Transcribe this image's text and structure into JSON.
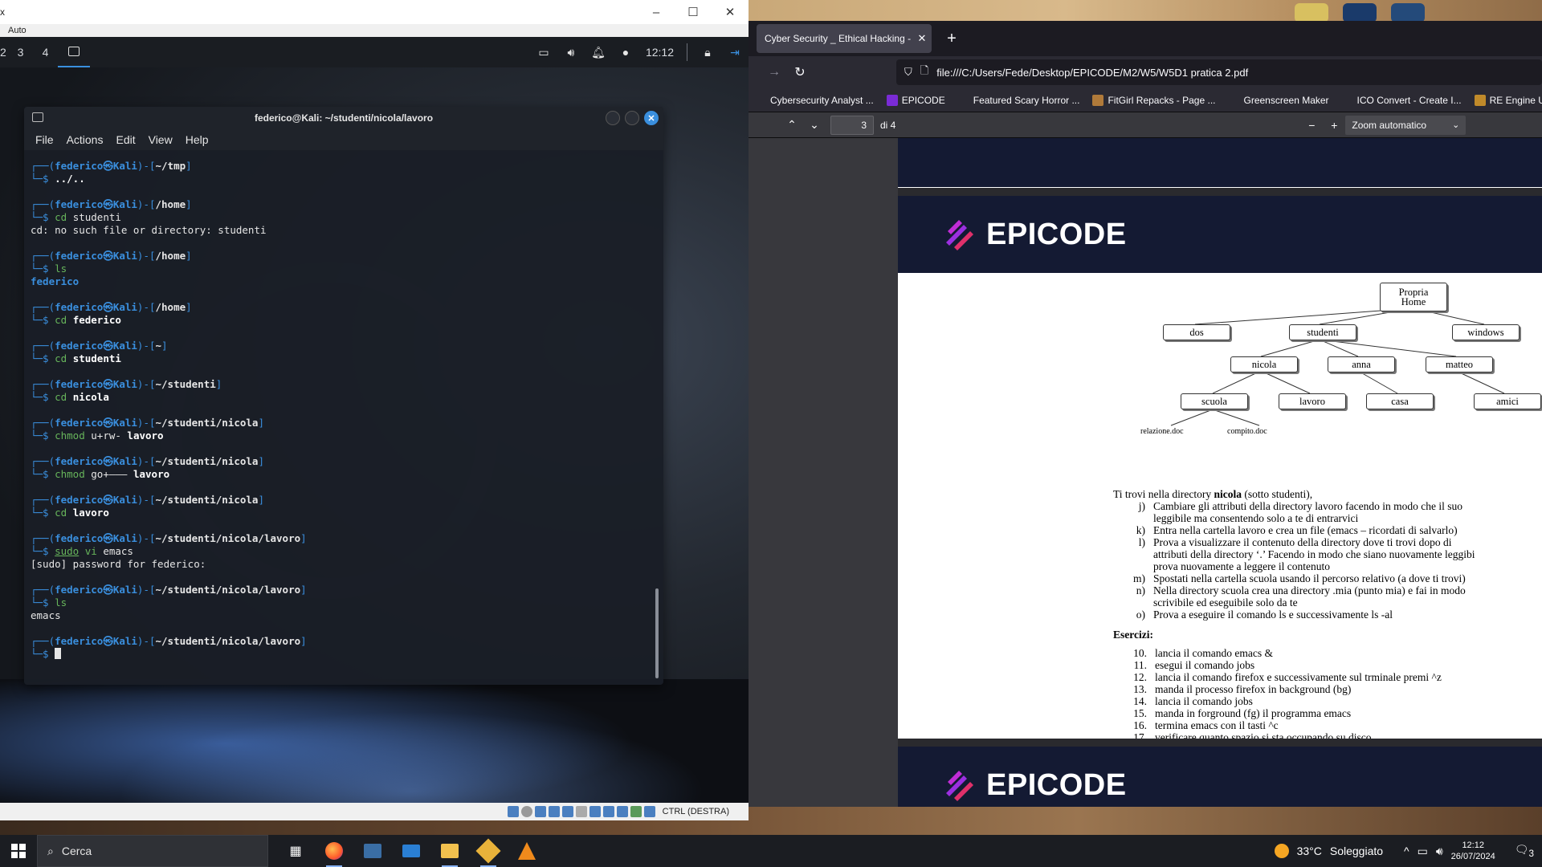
{
  "vbox": {
    "title_fragment": "x",
    "menu_item": "Auto",
    "status_label": "CTRL (DESTRA)"
  },
  "kali_panel": {
    "workspaces": [
      "2",
      "3",
      "4"
    ],
    "clock": "12:12"
  },
  "terminal": {
    "title": "federico@Kali: ~/studenti/nicola/lavoro",
    "menu": [
      "File",
      "Actions",
      "Edit",
      "View",
      "Help"
    ],
    "user": "federico",
    "host": "Kali",
    "blocks": [
      {
        "dir": "~/tmp",
        "cmd": "../..",
        "cmd_kind": "path",
        "output": ""
      },
      {
        "dir": "/home",
        "cmd": "cd",
        "arg": "studenti",
        "output": "cd: no such file or directory: studenti"
      },
      {
        "dir": "/home",
        "cmd": "ls",
        "arg": "",
        "output": "federico",
        "output_kind": "dir"
      },
      {
        "dir": "/home",
        "cmd": "cd",
        "arg": "federico",
        "arg_bold": true,
        "output": ""
      },
      {
        "dir": "~",
        "cmd": "cd",
        "arg": "studenti",
        "arg_bold": true,
        "output": ""
      },
      {
        "dir": "~/studenti",
        "cmd": "cd",
        "arg": "nicola",
        "arg_bold": true,
        "output": ""
      },
      {
        "dir": "~/studenti/nicola",
        "cmd": "chmod",
        "arg": "u+rw-",
        "arg2": "lavoro",
        "output": ""
      },
      {
        "dir": "~/studenti/nicola",
        "cmd": "chmod",
        "arg": "go+———",
        "arg2": "lavoro",
        "output": ""
      },
      {
        "dir": "~/studenti/nicola",
        "cmd": "cd",
        "arg": "lavoro",
        "arg_bold": true,
        "output": ""
      },
      {
        "dir": "~/studenti/nicola/lavoro",
        "cmd": "sudo",
        "arg": "vi",
        "arg2": "emacs",
        "output": "[sudo] password for federico:"
      },
      {
        "dir": "~/studenti/nicola/lavoro",
        "cmd": "ls",
        "arg": "",
        "output": "emacs"
      },
      {
        "dir": "~/studenti/nicola/lavoro",
        "cmd": "",
        "arg": "",
        "output": "",
        "cursor": true
      }
    ]
  },
  "browser": {
    "tab_title": "Cyber Security _ Ethical Hacking - N",
    "url": "file:///C:/Users/Fede/Desktop/EPICODE/M2/W5/W5D1 pratica 2.pdf",
    "bookmarks": [
      {
        "label": "Cybersecurity Analyst ...",
        "color": "#2b2a33"
      },
      {
        "label": "EPICODE",
        "color": "#7a2bd6"
      },
      {
        "label": "Featured Scary Horror ...",
        "color": "#2b2a33"
      },
      {
        "label": "FitGirl Repacks - Page ...",
        "color": "#b07a3a"
      },
      {
        "label": "Greenscreen Maker",
        "color": "#2b2a33"
      },
      {
        "label": "ICO Convert - Create I...",
        "color": "#2b2a33"
      },
      {
        "label": "RE Engine Ultimate M...",
        "color": "#c08a2a"
      }
    ],
    "pdf": {
      "page_current": "3",
      "page_total": "di 4",
      "zoom": "Zoom automatico",
      "brand": "EPICODE"
    }
  },
  "tree": {
    "root": "Propria Home",
    "level1": [
      "dos",
      "studenti",
      "windows"
    ],
    "level2": [
      "nicola",
      "anna",
      "matteo"
    ],
    "level3": [
      "scuola",
      "lavoro",
      "casa",
      "amici"
    ],
    "files": [
      "relazione.doc",
      "compito.doc"
    ]
  },
  "document": {
    "intro_pre": "Ti trovi nella directory ",
    "intro_bold": "nicola",
    "intro_post": " (sotto studenti),",
    "items": [
      {
        "tag": "j)",
        "lines": [
          "Cambiare gli attributi della directory lavoro facendo in modo che il suo",
          "leggibile ma consentendo solo a te di entrarvici"
        ]
      },
      {
        "tag": "k)",
        "lines": [
          "Entra nella cartella lavoro e crea un file (emacs – ricordati di salvarlo)"
        ]
      },
      {
        "tag": "l)",
        "lines": [
          "Prova a visualizzare il contenuto della directory dove ti trovi dopo di",
          "attributi della directory ‘.’ Facendo in modo che siano nuovamente leggibi",
          "prova nuovamente a leggere il contenuto"
        ]
      },
      {
        "tag": "m)",
        "lines": [
          "Spostati nella cartella scuola usando il percorso relativo (a dove ti trovi)"
        ]
      },
      {
        "tag": "n)",
        "lines": [
          "Nella directory scuola crea una directory .mia (punto mia) e fai in modo",
          "scrivibile ed eseguibile solo da te"
        ]
      },
      {
        "tag": "o)",
        "lines": [
          "Prova a eseguire il comando ls e successivamente ls -al"
        ]
      }
    ],
    "exercises_title": "Esercizi:",
    "exercises": [
      {
        "n": "10.",
        "t": "lancia il comando emacs &"
      },
      {
        "n": "11.",
        "t": "esegui il comando jobs"
      },
      {
        "n": "12.",
        "t": "lancia il comando firefox e successivamente sul trminale premi ^z"
      },
      {
        "n": "13.",
        "t": "manda il processo firefox in background (bg)"
      },
      {
        "n": "14.",
        "t": "lancia il comando jobs"
      },
      {
        "n": "15.",
        "t": "manda in forground (fg) il programma emacs"
      },
      {
        "n": "16.",
        "t": "termina emacs con il tasti ^c"
      },
      {
        "n": "17.",
        "t": "verificare quanto spazio si sta occupando su disco"
      }
    ]
  },
  "taskbar": {
    "search_placeholder": "Cerca",
    "weather_temp": "33°C",
    "weather_desc": "Soleggiato",
    "time": "12:12",
    "date": "26/07/2024",
    "notifications": "3"
  },
  "colors": {
    "kali_blue": "#3a8fde",
    "epicode_navy": "#141a33",
    "firefox_dark": "#1c1b22"
  }
}
